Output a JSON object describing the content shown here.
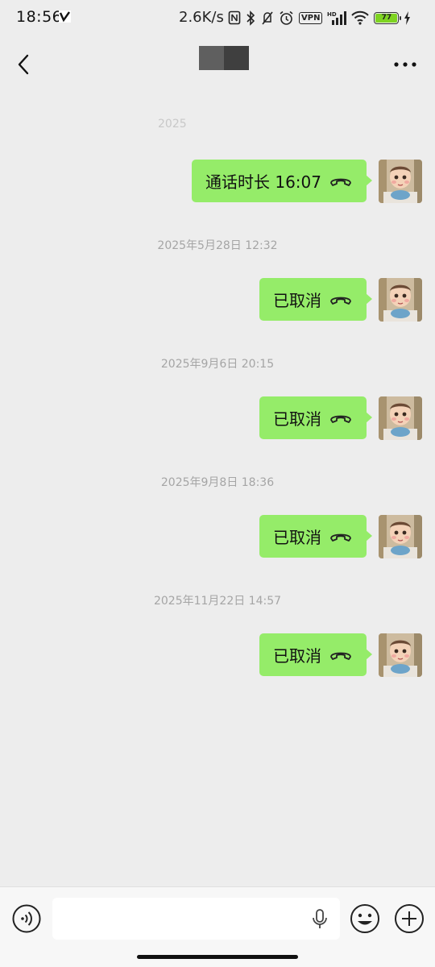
{
  "status_bar": {
    "time": "18:56",
    "network_speed": "2.6K/s",
    "vpn": "VPN",
    "signal_label": "HD",
    "battery": "77",
    "icons": [
      "carrier-v-icon",
      "nfc-icon",
      "bluetooth-icon",
      "mute-icon",
      "alarm-icon",
      "vpn-icon",
      "signal-icon",
      "wifi-icon",
      "battery-icon",
      "charging-icon"
    ]
  },
  "navbar": {
    "back_icon": "chevron-left-icon",
    "title": "",
    "more_icon": "more-dots-icon"
  },
  "messages": [
    {
      "timestamp": "2025",
      "timestamp_partial": true,
      "text": "通话时长 16:07",
      "icon": "hangup-phone-icon",
      "sender": "self"
    },
    {
      "timestamp": "2025年5月28日 12:32",
      "text": "已取消",
      "icon": "hangup-phone-icon",
      "sender": "self"
    },
    {
      "timestamp": "2025年9月6日 20:15",
      "text": "已取消",
      "icon": "hangup-phone-icon",
      "sender": "self"
    },
    {
      "timestamp": "2025年9月8日 18:36",
      "text": "已取消",
      "icon": "hangup-phone-icon",
      "sender": "self"
    },
    {
      "timestamp": "2025年11月22日 14:57",
      "text": "已取消",
      "icon": "hangup-phone-icon",
      "sender": "self"
    }
  ],
  "input_bar": {
    "voice_icon": "voice-mode-icon",
    "input_value": "",
    "mic_icon": "microphone-icon",
    "emoji_icon": "emoji-icon",
    "plus_icon": "plus-circle-icon"
  },
  "colors": {
    "background": "#ededed",
    "bubble_self": "#95ec69",
    "timestamp": "#a5a5a5",
    "input_bar": "#f7f7f7"
  }
}
